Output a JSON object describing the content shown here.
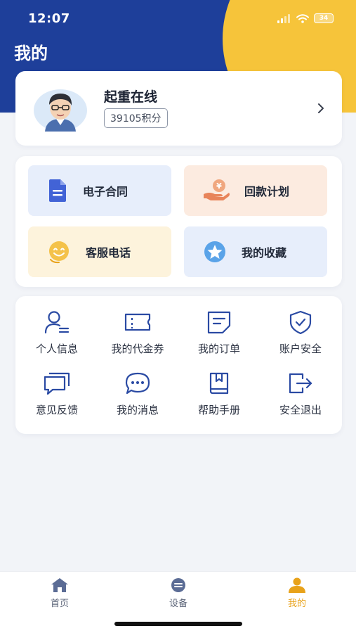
{
  "status_bar": {
    "time": "12:07",
    "battery": "34"
  },
  "page": {
    "title": "我的"
  },
  "profile": {
    "name": "起重在线",
    "points": "39105积分"
  },
  "quick_actions": [
    {
      "label": "电子合同",
      "icon": "document-icon"
    },
    {
      "label": "回款计划",
      "icon": "money-hand-icon"
    },
    {
      "label": "客服电话",
      "icon": "smile-icon"
    },
    {
      "label": "我的收藏",
      "icon": "star-icon"
    }
  ],
  "menu": [
    {
      "label": "个人信息",
      "icon": "person-info-icon"
    },
    {
      "label": "我的代金券",
      "icon": "coupon-icon"
    },
    {
      "label": "我的订单",
      "icon": "order-icon"
    },
    {
      "label": "账户安全",
      "icon": "shield-icon"
    },
    {
      "label": "意见反馈",
      "icon": "feedback-icon"
    },
    {
      "label": "我的消息",
      "icon": "message-icon"
    },
    {
      "label": "帮助手册",
      "icon": "book-icon"
    },
    {
      "label": "安全退出",
      "icon": "logout-icon"
    }
  ],
  "tabs": [
    {
      "label": "首页",
      "icon": "home-icon"
    },
    {
      "label": "设备",
      "icon": "device-icon"
    },
    {
      "label": "我的",
      "icon": "user-icon"
    }
  ],
  "colors": {
    "primary": "#1e3f9a",
    "accent": "#f6c43a",
    "active_tab": "#e8a21a",
    "icon_blue": "#2a4aa3"
  }
}
